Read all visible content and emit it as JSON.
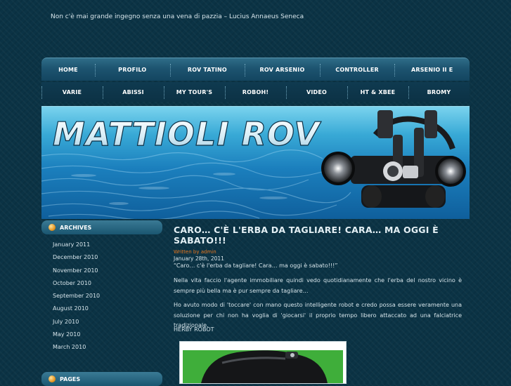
{
  "tagline": "Non c'è mai grande ingegno senza una vena di pazzia – Lucius Annaeus Seneca",
  "nav": {
    "row1": [
      "HOME",
      "PROFILO",
      "ROV TATINO",
      "ROV ARSENIO",
      "CONTROLLER",
      "ARSENIO II E"
    ],
    "row2": [
      "VARIE",
      "ABISSI",
      "MY TOUR'S",
      "ROBOH!",
      "VIDEO",
      "HT & XBEE",
      "BROMY"
    ]
  },
  "banner": {
    "logo_text": "MATTIOLI ROV"
  },
  "sidebar": {
    "archives_title": "ARCHIVES",
    "archives": [
      "January 2011",
      "December 2010",
      "November 2010",
      "October 2010",
      "September 2010",
      "August 2010",
      "July 2010",
      "May 2010",
      "March 2010"
    ],
    "pages_title": "PAGES"
  },
  "post": {
    "title": "CARO… C'È L'ERBA DA TAGLIARE! CARA… MA OGGI È SABATO!!!",
    "author": "Written by admin",
    "date": "January 28th, 2011",
    "p1": "“Caro… c'è l'erba da tagliare! Cara… ma oggi è sabato!!!”",
    "p2": "Nella vita faccio l'agente immobiliare quindi vedo quotidianamente che l'erba del nostro vicino è sempre più bella ma è pur sempre da tagliare…",
    "p3": "Ho avuto modo di 'toccare' con mano questo intelligente robot e credo possa essere veramente una soluzione per chi non ha voglia di 'giocarsi' il proprio tempo libero attaccato ad una falciatrice tradizionale.",
    "p4": "HERBY ROBOT"
  },
  "colors": {
    "background": "#0b3345",
    "accent_orange": "#e8761e",
    "nav_gradient_top": "#2f6d88"
  }
}
